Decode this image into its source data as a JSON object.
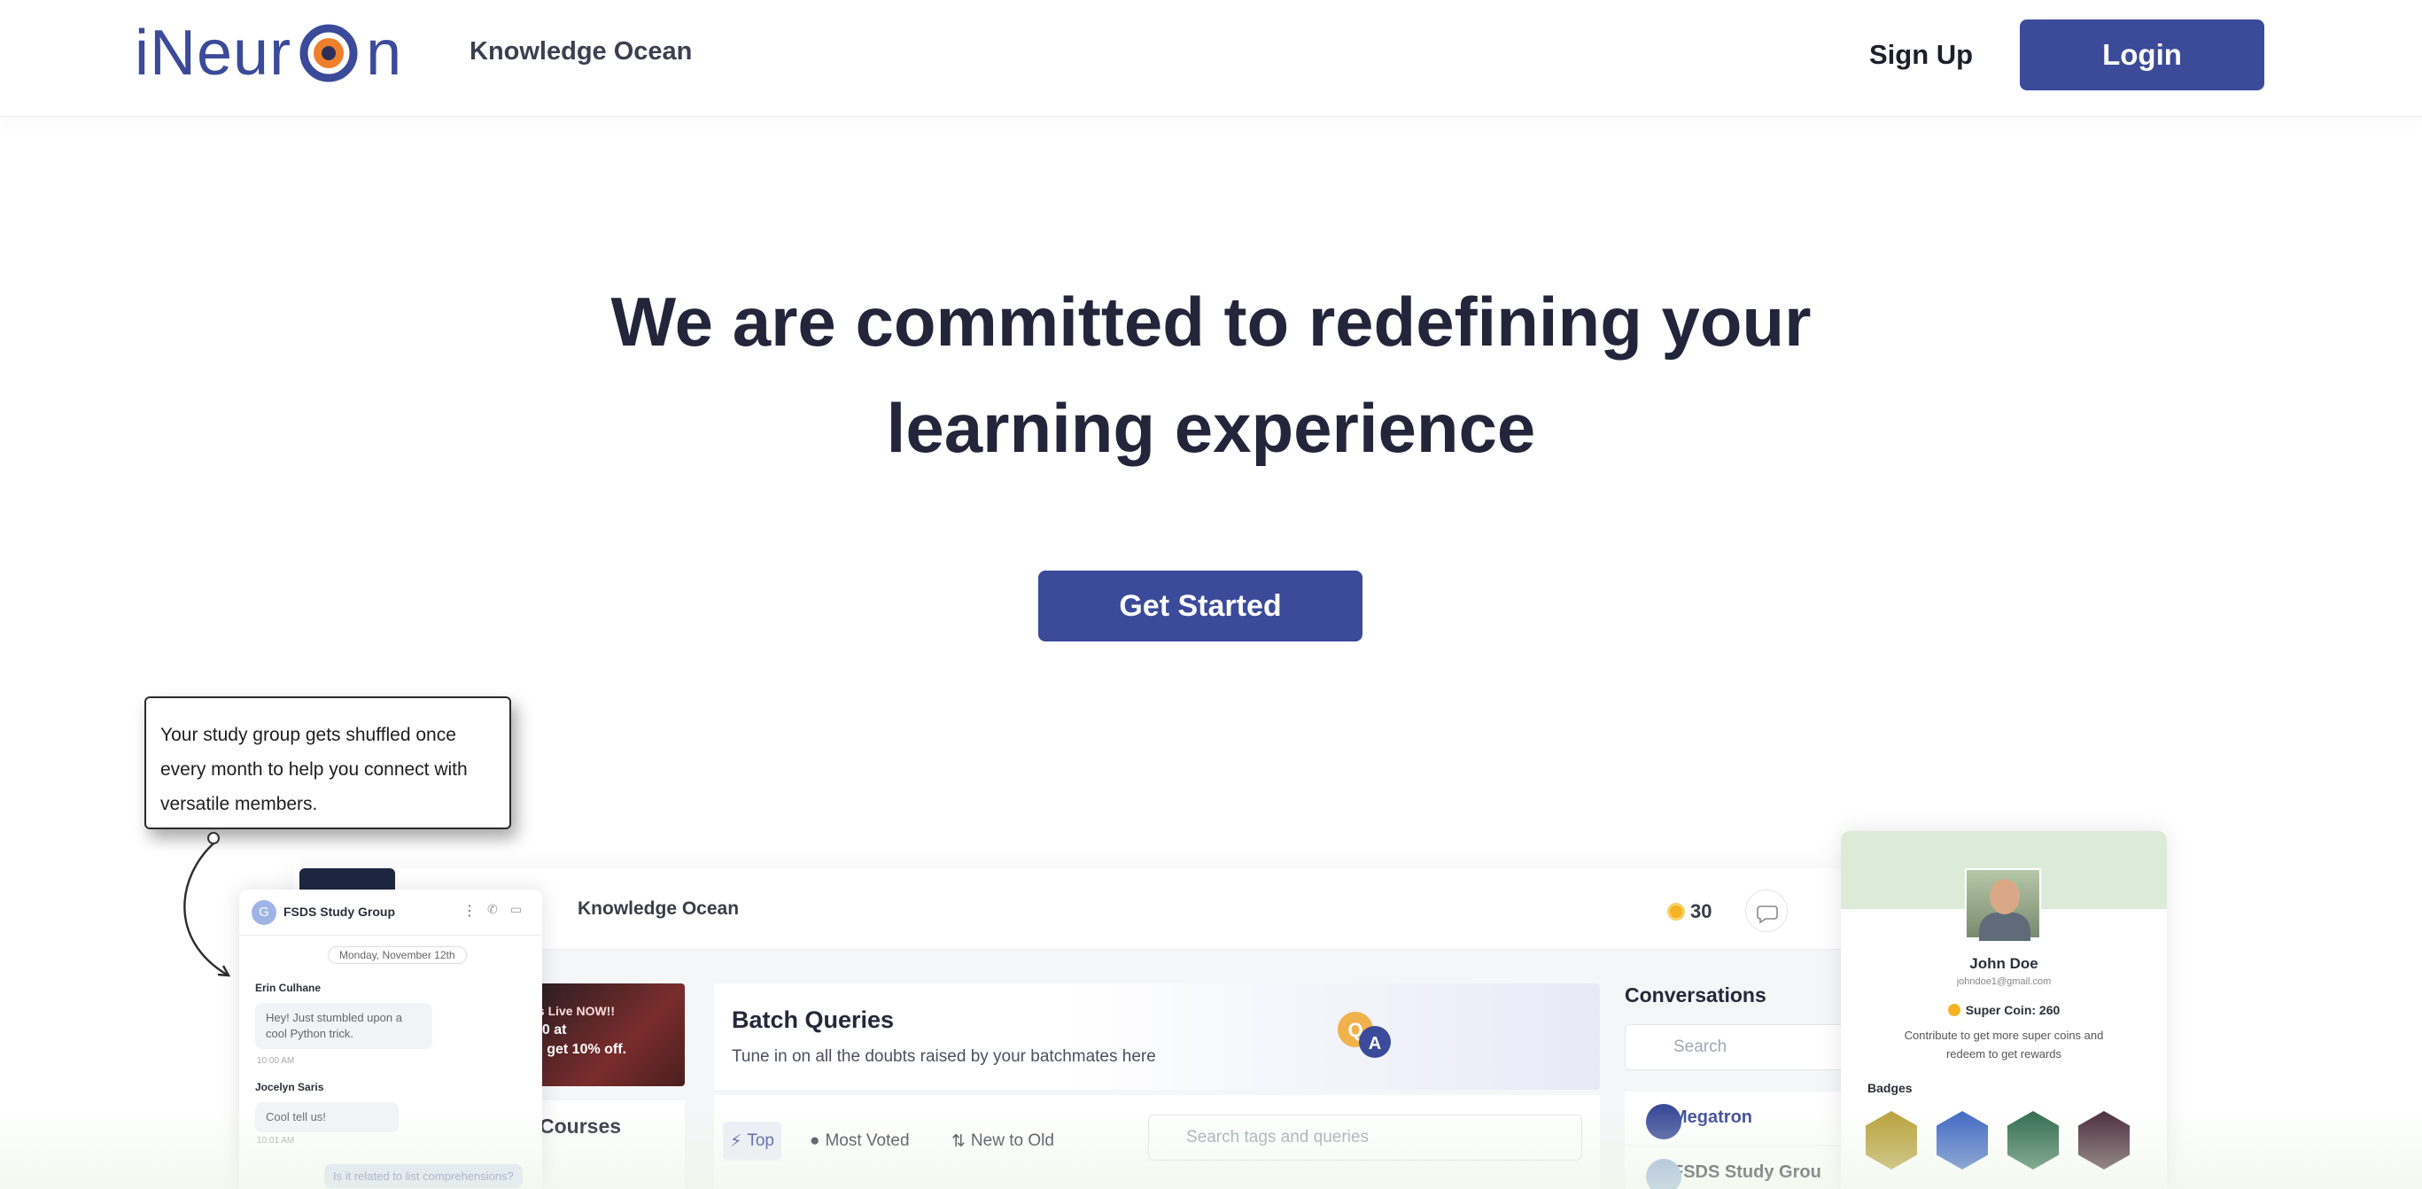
{
  "header": {
    "logo_text": "iNeuron",
    "knowledge_ocean": "Knowledge Ocean",
    "signup_label": "Sign Up",
    "login_label": "Login"
  },
  "hero": {
    "line1": "We are committed to redefining your",
    "line2": "learning experience",
    "cta_label": "Get Started"
  },
  "tooltip": {
    "text_line1": "Your study group gets shuffled once",
    "text_line2": "every month to help you connect with",
    "text_line3": "versatile members."
  },
  "preview": {
    "knowledge_ocean": "Knowledge Ocean",
    "coins": "30",
    "promo_line1": "is Live NOW!!",
    "promo_line2": "10 at",
    "promo_line3": "o get 10% off.",
    "courses_label": "Courses",
    "batch_title": "Batch Queries",
    "batch_subtitle": "Tune in on all the doubts raised by your batchmates here",
    "tabs": [
      "Top",
      "Most Voted",
      "New to Old"
    ],
    "search_placeholder": "Search tags and queries",
    "conversations_title": "Conversations",
    "conversations_search": "Search",
    "conversations": [
      "Megatron",
      "FSDS Study Grou"
    ]
  },
  "chat": {
    "group_initial": "G",
    "group_name": "FSDS Study Group",
    "date": "Monday, November 12th",
    "msg1_author": "Erin Culhane",
    "msg1_text": "Hey! Just stumbled upon a cool Python trick.",
    "msg1_time": "10:00 AM",
    "msg2_author": "Jocelyn Saris",
    "msg2_text": "Cool tell us!",
    "msg2_time": "10:01 AM",
    "my_msg": "Is it related to list comprehensions?"
  },
  "profile": {
    "name": "John Doe",
    "email": "johndoe1@gmail.com",
    "super_coin": "Super Coin: 260",
    "contribute": "Contribute to get more super coins and redeem to get rewards",
    "badges_label": "Badges",
    "badge_colors": [
      "#b8a13a",
      "#3f67c4",
      "#2f6b4e",
      "#4a2b3a"
    ]
  },
  "colors": {
    "brand": "#3b4a99",
    "logo_accent": "#f07f2b",
    "text_dark": "#23263a"
  }
}
